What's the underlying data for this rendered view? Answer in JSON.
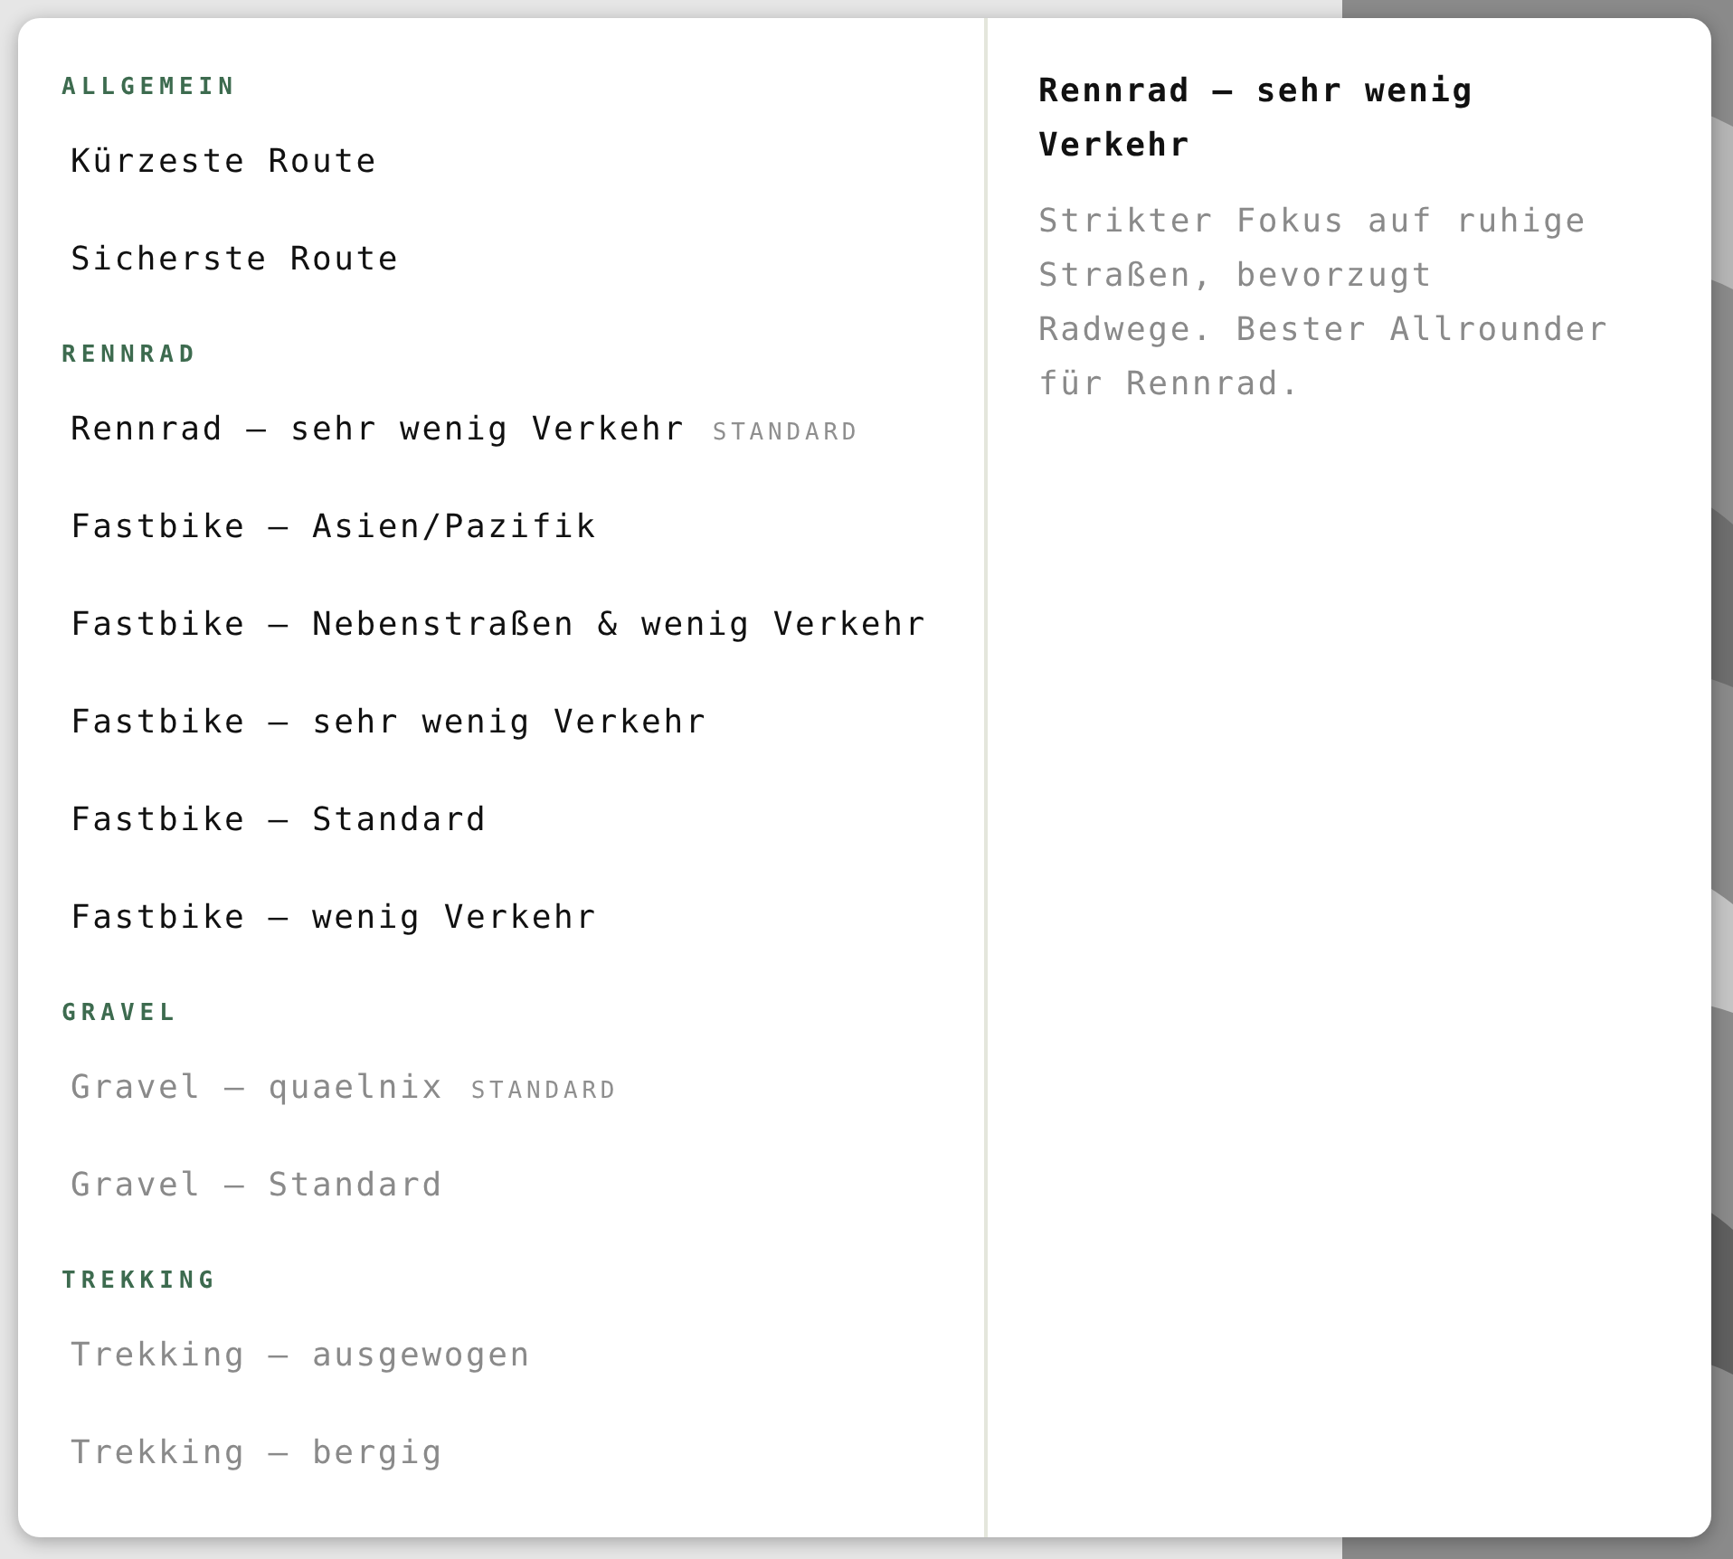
{
  "groups": [
    {
      "heading": "ALLGEMEIN",
      "items": [
        {
          "label": "Kürzeste Route",
          "disabled": false
        },
        {
          "label": "Sicherste Route",
          "disabled": false
        }
      ]
    },
    {
      "heading": "RENNRAD",
      "items": [
        {
          "label": "Rennrad — sehr wenig Verkehr",
          "badge": "STANDARD",
          "disabled": false
        },
        {
          "label": "Fastbike — Asien/Pazifik",
          "disabled": false
        },
        {
          "label": "Fastbike — Nebenstraßen & wenig Verkehr",
          "disabled": false
        },
        {
          "label": "Fastbike — sehr wenig Verkehr",
          "disabled": false
        },
        {
          "label": "Fastbike — Standard",
          "disabled": false
        },
        {
          "label": "Fastbike — wenig Verkehr",
          "disabled": false
        }
      ]
    },
    {
      "heading": "GRAVEL",
      "items": [
        {
          "label": "Gravel — quaelnix",
          "badge": "STANDARD",
          "disabled": true
        },
        {
          "label": "Gravel — Standard",
          "disabled": true
        }
      ]
    },
    {
      "heading": "TREKKING",
      "items": [
        {
          "label": "Trekking — ausgewogen",
          "disabled": true
        },
        {
          "label": "Trekking — bergig",
          "disabled": true
        }
      ]
    }
  ],
  "detail": {
    "title": "Rennrad — sehr wenig Verkehr",
    "description": "Strikter Fokus auf ruhige Straßen, bevorzugt Radwege. Bester Allrounder für Rennrad."
  }
}
